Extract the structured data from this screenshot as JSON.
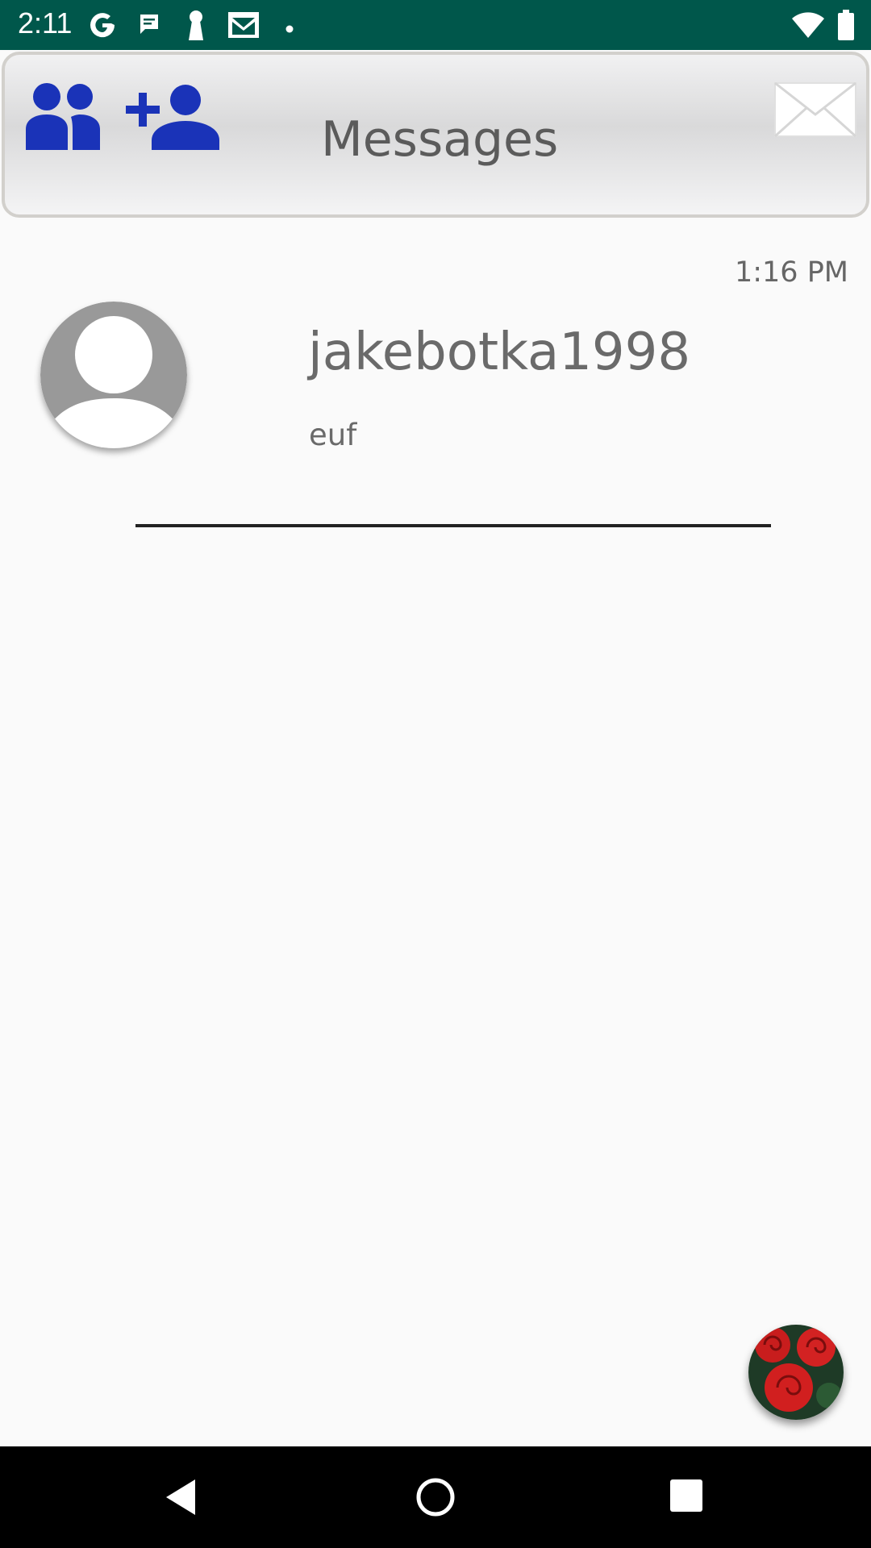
{
  "status_bar": {
    "time": "2:11",
    "left_icons": [
      "google-icon",
      "chat-icon",
      "keyhole-icon",
      "gmail-icon",
      "dot-icon"
    ],
    "right_icons": [
      "wifi-icon",
      "battery-icon"
    ]
  },
  "header": {
    "title": "Messages",
    "buttons": [
      "friends-icon",
      "add-friend-icon",
      "mail-icon"
    ],
    "accent_color": "#1a33b8"
  },
  "conversations": [
    {
      "time": "1:16 PM",
      "name": "jakebotka1998",
      "preview": "euf",
      "avatar": "default-avatar-icon"
    }
  ],
  "fab": {
    "icon": "roses-image"
  },
  "nav_bar": {
    "buttons": [
      "back-icon",
      "home-icon",
      "recents-icon"
    ]
  },
  "colors": {
    "status_bar": "#00574b",
    "background": "#fafafa",
    "text": "#6a6a6a"
  }
}
